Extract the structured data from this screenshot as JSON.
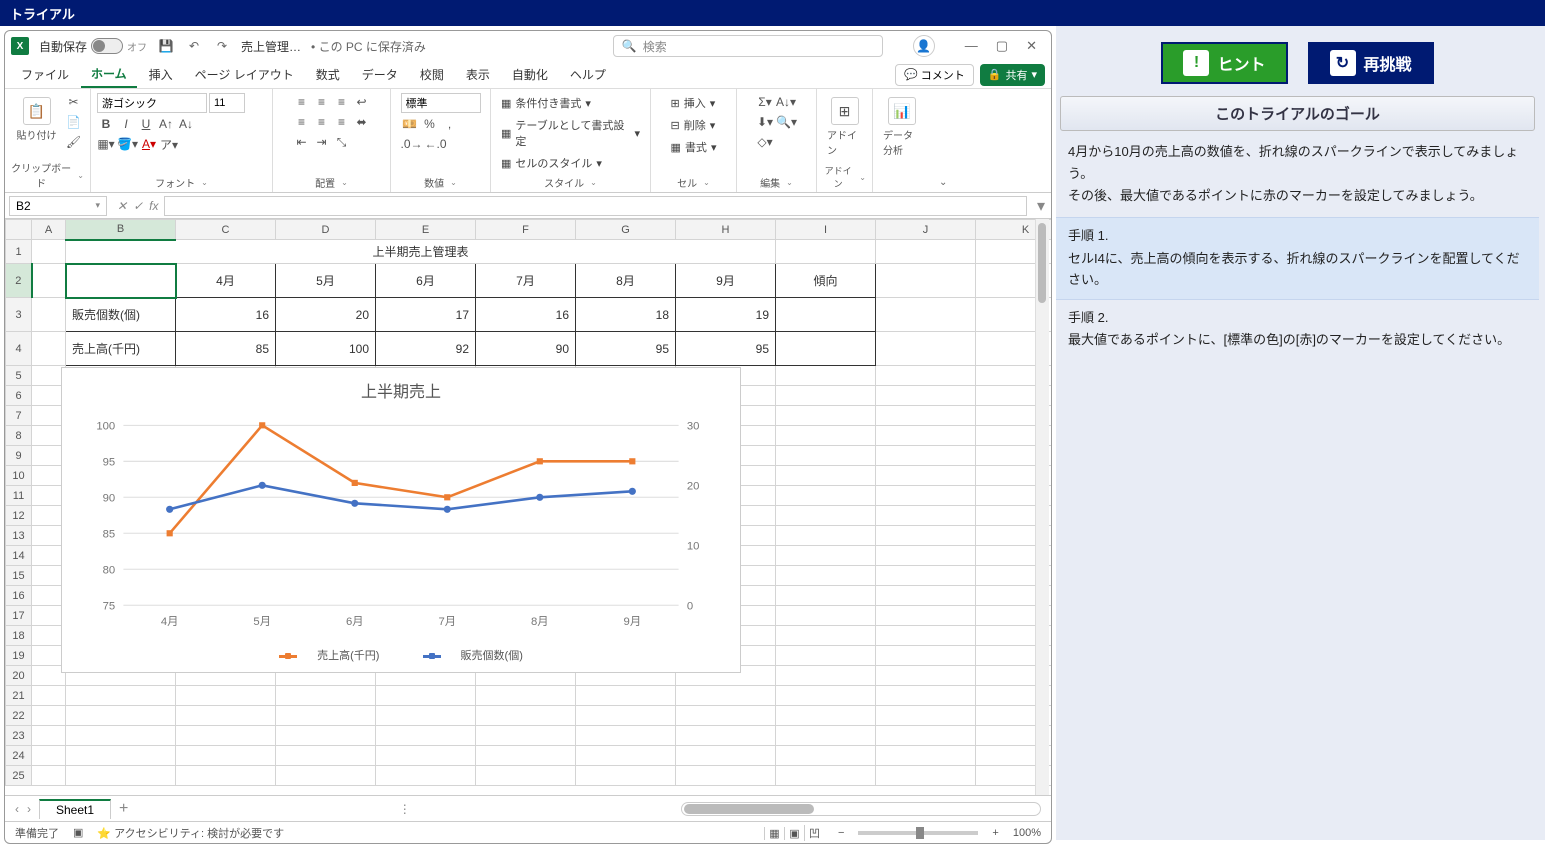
{
  "app_title": "トライアル",
  "excel": {
    "autosave_label": "自動保存",
    "autosave_state": "オフ",
    "filename": "売上管理…",
    "save_location": "• この PC に保存済み",
    "search_placeholder": "検索",
    "tabs": [
      "ファイル",
      "ホーム",
      "挿入",
      "ページ レイアウト",
      "数式",
      "データ",
      "校閲",
      "表示",
      "自動化",
      "ヘルプ"
    ],
    "active_tab": "ホーム",
    "comment_btn": "コメント",
    "share_btn": "共有",
    "ribbon": {
      "clipboard": "クリップボード",
      "paste": "貼り付け",
      "font_group": "フォント",
      "font_name": "游ゴシック",
      "font_size": "11",
      "alignment": "配置",
      "number_group": "数値",
      "number_format": "標準",
      "styles": "スタイル",
      "cond_format": "条件付き書式",
      "format_table": "テーブルとして書式設定",
      "cell_styles": "セルのスタイル",
      "cells": "セル",
      "insert": "挿入",
      "delete": "削除",
      "format": "書式",
      "editing": "編集",
      "addin": "アドイン",
      "addin_btn": "アドイン",
      "analysis": "データ分析"
    },
    "name_box": "B2",
    "sheet_name": "Sheet1",
    "status": {
      "ready": "準備完了",
      "accessibility": "アクセシビリティ: 検討が必要です",
      "zoom": "100%"
    }
  },
  "worksheet": {
    "title": "上半期売上管理表",
    "months": [
      "4月",
      "5月",
      "6月",
      "7月",
      "8月",
      "9月"
    ],
    "trend_header": "傾向",
    "row1_label": "販売個数(個)",
    "row1_values": [
      16,
      20,
      17,
      16,
      18,
      19
    ],
    "row2_label": "売上高(千円)",
    "row2_values": [
      85,
      100,
      92,
      90,
      95,
      95
    ]
  },
  "chart_data": {
    "type": "line",
    "title": "上半期売上",
    "categories": [
      "4月",
      "5月",
      "6月",
      "7月",
      "8月",
      "9月"
    ],
    "series": [
      {
        "name": "売上高(千円)",
        "axis": "left",
        "values": [
          85,
          100,
          92,
          90,
          95,
          95
        ]
      },
      {
        "name": "販売個数(個)",
        "axis": "right",
        "values": [
          16,
          20,
          17,
          16,
          18,
          19
        ]
      }
    ],
    "y_left": {
      "ticks": [
        75,
        80,
        85,
        90,
        95,
        100
      ]
    },
    "y_right": {
      "ticks": [
        0,
        10,
        20,
        30
      ]
    }
  },
  "right_panel": {
    "hint_btn": "ヒント",
    "retry_btn": "再挑戦",
    "goal_header": "このトライアルのゴール",
    "goal_text_1": "4月から10月の売上高の数値を、折れ線のスパークラインで表示してみましょう。",
    "goal_text_2": "その後、最大値であるポイントに赤のマーカーを設定してみましょう。",
    "step1_label": "手順 1.",
    "step1_text": "セルI4に、売上高の傾向を表示する、折れ線のスパークラインを配置してください。",
    "step2_label": "手順 2.",
    "step2_text": "最大値であるポイントに、[標準の色]の[赤]のマーカーを設定してください。"
  }
}
